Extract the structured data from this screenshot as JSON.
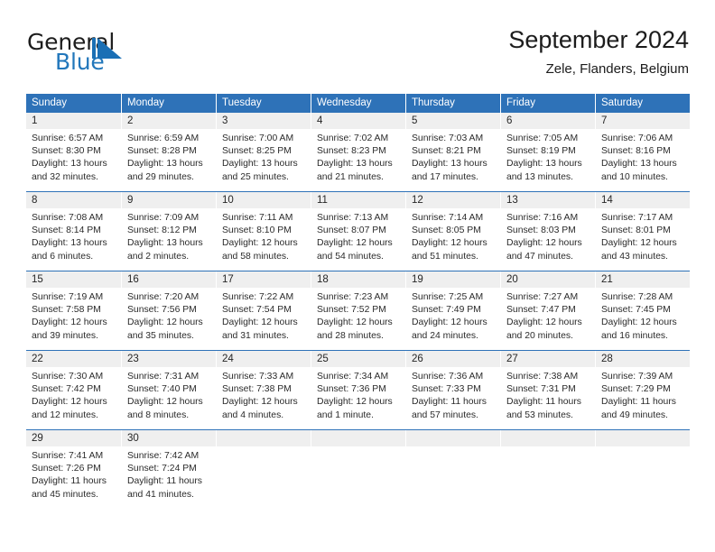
{
  "brand": {
    "name_part1": "General",
    "name_part2": "Blue",
    "logo_icon": "triangle-icon",
    "color_blue": "#2277bb",
    "color_dark": "#1c1c1c"
  },
  "header": {
    "title": "September 2024",
    "subtitle": "Zele, Flanders, Belgium"
  },
  "theme": {
    "header_blue": "#2e72b8",
    "row_divider_blue": "#2e72b8",
    "daynum_bg": "#efefef"
  },
  "calendar": {
    "weekdays": [
      "Sunday",
      "Monday",
      "Tuesday",
      "Wednesday",
      "Thursday",
      "Friday",
      "Saturday"
    ],
    "weeks": [
      [
        {
          "day": "1",
          "lines": [
            "Sunrise: 6:57 AM",
            "Sunset: 8:30 PM",
            "Daylight: 13 hours",
            "and 32 minutes."
          ]
        },
        {
          "day": "2",
          "lines": [
            "Sunrise: 6:59 AM",
            "Sunset: 8:28 PM",
            "Daylight: 13 hours",
            "and 29 minutes."
          ]
        },
        {
          "day": "3",
          "lines": [
            "Sunrise: 7:00 AM",
            "Sunset: 8:25 PM",
            "Daylight: 13 hours",
            "and 25 minutes."
          ]
        },
        {
          "day": "4",
          "lines": [
            "Sunrise: 7:02 AM",
            "Sunset: 8:23 PM",
            "Daylight: 13 hours",
            "and 21 minutes."
          ]
        },
        {
          "day": "5",
          "lines": [
            "Sunrise: 7:03 AM",
            "Sunset: 8:21 PM",
            "Daylight: 13 hours",
            "and 17 minutes."
          ]
        },
        {
          "day": "6",
          "lines": [
            "Sunrise: 7:05 AM",
            "Sunset: 8:19 PM",
            "Daylight: 13 hours",
            "and 13 minutes."
          ]
        },
        {
          "day": "7",
          "lines": [
            "Sunrise: 7:06 AM",
            "Sunset: 8:16 PM",
            "Daylight: 13 hours",
            "and 10 minutes."
          ]
        }
      ],
      [
        {
          "day": "8",
          "lines": [
            "Sunrise: 7:08 AM",
            "Sunset: 8:14 PM",
            "Daylight: 13 hours",
            "and 6 minutes."
          ]
        },
        {
          "day": "9",
          "lines": [
            "Sunrise: 7:09 AM",
            "Sunset: 8:12 PM",
            "Daylight: 13 hours",
            "and 2 minutes."
          ]
        },
        {
          "day": "10",
          "lines": [
            "Sunrise: 7:11 AM",
            "Sunset: 8:10 PM",
            "Daylight: 12 hours",
            "and 58 minutes."
          ]
        },
        {
          "day": "11",
          "lines": [
            "Sunrise: 7:13 AM",
            "Sunset: 8:07 PM",
            "Daylight: 12 hours",
            "and 54 minutes."
          ]
        },
        {
          "day": "12",
          "lines": [
            "Sunrise: 7:14 AM",
            "Sunset: 8:05 PM",
            "Daylight: 12 hours",
            "and 51 minutes."
          ]
        },
        {
          "day": "13",
          "lines": [
            "Sunrise: 7:16 AM",
            "Sunset: 8:03 PM",
            "Daylight: 12 hours",
            "and 47 minutes."
          ]
        },
        {
          "day": "14",
          "lines": [
            "Sunrise: 7:17 AM",
            "Sunset: 8:01 PM",
            "Daylight: 12 hours",
            "and 43 minutes."
          ]
        }
      ],
      [
        {
          "day": "15",
          "lines": [
            "Sunrise: 7:19 AM",
            "Sunset: 7:58 PM",
            "Daylight: 12 hours",
            "and 39 minutes."
          ]
        },
        {
          "day": "16",
          "lines": [
            "Sunrise: 7:20 AM",
            "Sunset: 7:56 PM",
            "Daylight: 12 hours",
            "and 35 minutes."
          ]
        },
        {
          "day": "17",
          "lines": [
            "Sunrise: 7:22 AM",
            "Sunset: 7:54 PM",
            "Daylight: 12 hours",
            "and 31 minutes."
          ]
        },
        {
          "day": "18",
          "lines": [
            "Sunrise: 7:23 AM",
            "Sunset: 7:52 PM",
            "Daylight: 12 hours",
            "and 28 minutes."
          ]
        },
        {
          "day": "19",
          "lines": [
            "Sunrise: 7:25 AM",
            "Sunset: 7:49 PM",
            "Daylight: 12 hours",
            "and 24 minutes."
          ]
        },
        {
          "day": "20",
          "lines": [
            "Sunrise: 7:27 AM",
            "Sunset: 7:47 PM",
            "Daylight: 12 hours",
            "and 20 minutes."
          ]
        },
        {
          "day": "21",
          "lines": [
            "Sunrise: 7:28 AM",
            "Sunset: 7:45 PM",
            "Daylight: 12 hours",
            "and 16 minutes."
          ]
        }
      ],
      [
        {
          "day": "22",
          "lines": [
            "Sunrise: 7:30 AM",
            "Sunset: 7:42 PM",
            "Daylight: 12 hours",
            "and 12 minutes."
          ]
        },
        {
          "day": "23",
          "lines": [
            "Sunrise: 7:31 AM",
            "Sunset: 7:40 PM",
            "Daylight: 12 hours",
            "and 8 minutes."
          ]
        },
        {
          "day": "24",
          "lines": [
            "Sunrise: 7:33 AM",
            "Sunset: 7:38 PM",
            "Daylight: 12 hours",
            "and 4 minutes."
          ]
        },
        {
          "day": "25",
          "lines": [
            "Sunrise: 7:34 AM",
            "Sunset: 7:36 PM",
            "Daylight: 12 hours",
            "and 1 minute."
          ]
        },
        {
          "day": "26",
          "lines": [
            "Sunrise: 7:36 AM",
            "Sunset: 7:33 PM",
            "Daylight: 11 hours",
            "and 57 minutes."
          ]
        },
        {
          "day": "27",
          "lines": [
            "Sunrise: 7:38 AM",
            "Sunset: 7:31 PM",
            "Daylight: 11 hours",
            "and 53 minutes."
          ]
        },
        {
          "day": "28",
          "lines": [
            "Sunrise: 7:39 AM",
            "Sunset: 7:29 PM",
            "Daylight: 11 hours",
            "and 49 minutes."
          ]
        }
      ],
      [
        {
          "day": "29",
          "lines": [
            "Sunrise: 7:41 AM",
            "Sunset: 7:26 PM",
            "Daylight: 11 hours",
            "and 45 minutes."
          ]
        },
        {
          "day": "30",
          "lines": [
            "Sunrise: 7:42 AM",
            "Sunset: 7:24 PM",
            "Daylight: 11 hours",
            "and 41 minutes."
          ]
        },
        {
          "day": "",
          "lines": []
        },
        {
          "day": "",
          "lines": []
        },
        {
          "day": "",
          "lines": []
        },
        {
          "day": "",
          "lines": []
        },
        {
          "day": "",
          "lines": []
        }
      ]
    ]
  }
}
